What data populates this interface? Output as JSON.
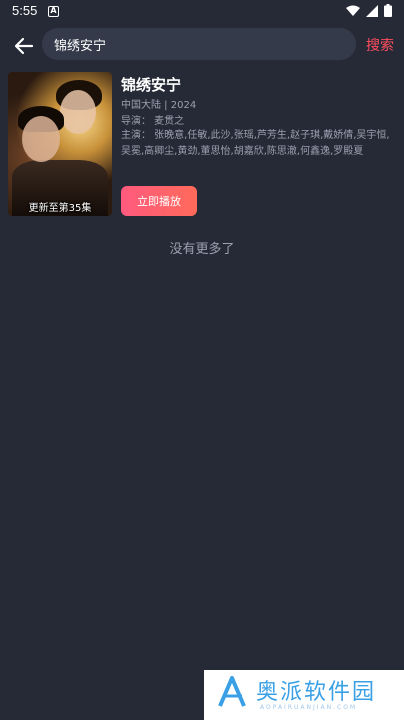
{
  "status": {
    "time": "5:55",
    "a_icon": "A"
  },
  "search": {
    "query": "锦绣安宁",
    "button": "搜索"
  },
  "result": {
    "title": "锦绣安宁",
    "meta": "中国大陆 | 2024",
    "director": "导演：  麦贯之",
    "cast": "主演：  张晚意,任敏,此沙,张瑶,芦芳生,赵子琪,戴娇倩,吴宇恒,吴冕,高卿尘,黄劲,董思怡,胡嘉欣,陈思澈,何鑫逸,罗殿夏",
    "poster_caption": "更新至第35集",
    "play_button": "立即播放"
  },
  "footer": {
    "no_more": "没有更多了"
  },
  "watermark": {
    "text": "奥派软件园",
    "sub": "AOPAIRUANJIAN.COM"
  },
  "colors": {
    "background": "#262a36",
    "accent": "#ff4d5e",
    "input_bg": "#353a4a",
    "muted": "#9aa0b0"
  }
}
